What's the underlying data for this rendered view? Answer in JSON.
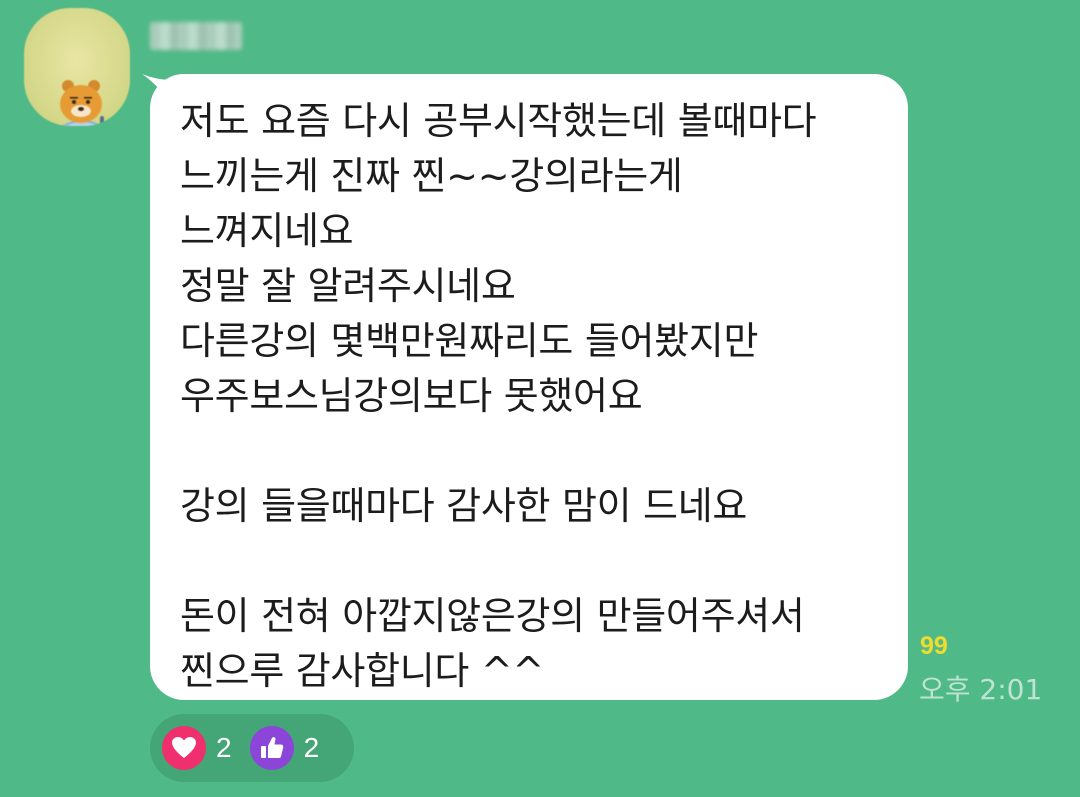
{
  "sender": {
    "avatar_icon": "character-avatar-icon",
    "name": ""
  },
  "message": {
    "lines": [
      "저도 요즘 다시 공부시작했는데 볼때마다",
      "느끼는게 진짜 찐~~강의라는게",
      "느껴지네요",
      "정말 잘 알려주시네요",
      "다른강의 몇백만원짜리도 들어봤지만",
      "우주보스님강의보다 못했어요",
      "",
      "강의 들을때마다 감사한 맘이 드네요",
      "",
      "돈이 전혀 아깝지않은강의 만들어주셔서",
      "찐으루 감사합니다 ^^"
    ],
    "unread_count": "99",
    "time": "오후 2:01"
  },
  "reactions": [
    {
      "icon": "heart-icon",
      "count": "2",
      "color": "#f0306e"
    },
    {
      "icon": "thumbs-up-icon",
      "count": "2",
      "color": "#8b45d9"
    }
  ],
  "colors": {
    "background": "#4fb987",
    "bubble": "#ffffff",
    "unread": "#f0dc2c",
    "time": "#bfe3d2"
  }
}
